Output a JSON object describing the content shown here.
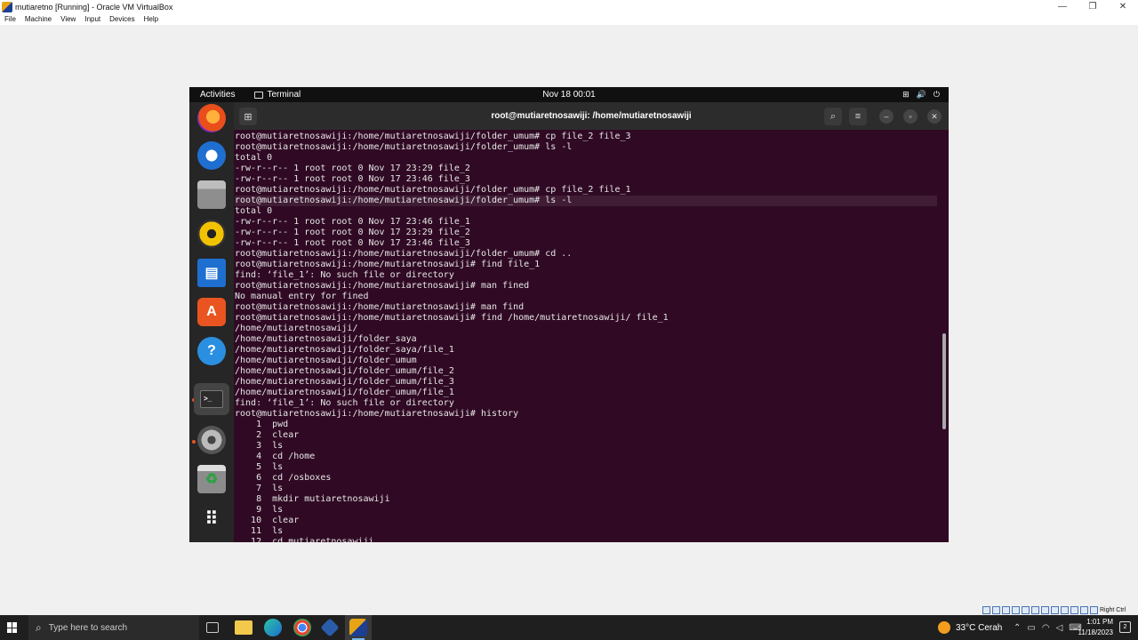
{
  "host": {
    "title": "mutiaretno [Running] - Oracle VM VirtualBox",
    "controls": [
      "—",
      "❐",
      "✕"
    ],
    "menu": [
      "File",
      "Machine",
      "View",
      "Input",
      "Devices",
      "Help"
    ]
  },
  "gnome": {
    "activities": "Activities",
    "app": "Terminal",
    "clock": "Nov 18  00:01",
    "tray": [
      "⊞",
      "🔊",
      "⏻"
    ]
  },
  "terminal": {
    "title": "root@mutiaretnosawiji: /home/mutiaretnosawiji",
    "lines": [
      "root@mutiaretnosawiji:/home/mutiaretnosawiji/folder_umum# cp file_2 file_3",
      "root@mutiaretnosawiji:/home/mutiaretnosawiji/folder_umum# ls -l",
      "total 0",
      "-rw-r--r-- 1 root root 0 Nov 17 23:29 file_2",
      "-rw-r--r-- 1 root root 0 Nov 17 23:46 file_3",
      "root@mutiaretnosawiji:/home/mutiaretnosawiji/folder_umum# cp file_2 file_1",
      "root@mutiaretnosawiji:/home/mutiaretnosawiji/folder_umum# ls -l",
      "total 0",
      "-rw-r--r-- 1 root root 0 Nov 17 23:46 file_1",
      "-rw-r--r-- 1 root root 0 Nov 17 23:29 file_2",
      "-rw-r--r-- 1 root root 0 Nov 17 23:46 file_3",
      "root@mutiaretnosawiji:/home/mutiaretnosawiji/folder_umum# cd ..",
      "root@mutiaretnosawiji:/home/mutiaretnosawiji# find file_1",
      "find: ‘file_1’: No such file or directory",
      "root@mutiaretnosawiji:/home/mutiaretnosawiji# man fined",
      "No manual entry for fined",
      "root@mutiaretnosawiji:/home/mutiaretnosawiji# man find",
      "root@mutiaretnosawiji:/home/mutiaretnosawiji# find /home/mutiaretnosawiji/ file_1",
      "/home/mutiaretnosawiji/",
      "/home/mutiaretnosawiji/folder_saya",
      "/home/mutiaretnosawiji/folder_saya/file_1",
      "/home/mutiaretnosawiji/folder_umum",
      "/home/mutiaretnosawiji/folder_umum/file_2",
      "/home/mutiaretnosawiji/folder_umum/file_3",
      "/home/mutiaretnosawiji/folder_umum/file_1",
      "find: ‘file_1’: No such file or directory",
      "root@mutiaretnosawiji:/home/mutiaretnosawiji# history",
      "    1  pwd",
      "    2  clear",
      "    3  ls",
      "    4  cd /home",
      "    5  ls",
      "    6  cd /osboxes",
      "    7  ls",
      "    8  mkdir mutiaretnosawiji",
      "    9  ls",
      "   10  clear",
      "   11  ls",
      "   12  cd mutiaretnosawiji"
    ]
  },
  "taskbar": {
    "search_placeholder": "Type here to search",
    "weather": "33°C  Cerah",
    "time": "1:01 PM",
    "date": "11/18/2023",
    "notifications": "2",
    "right_ctrl": "Right Ctrl"
  }
}
